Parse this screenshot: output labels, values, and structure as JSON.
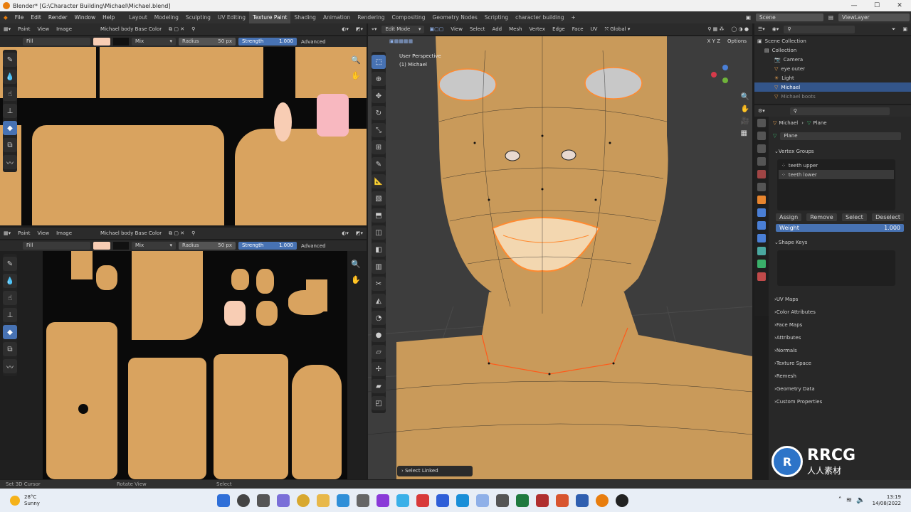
{
  "titlebar": {
    "title": "Blender* [G:\\Character Building\\Michael\\Michael.blend]",
    "min": "—",
    "max": "☐",
    "close": "✕"
  },
  "menu": [
    "File",
    "Edit",
    "Render",
    "Window",
    "Help"
  ],
  "workspaces": [
    "Layout",
    "Modeling",
    "Sculpting",
    "UV Editing",
    "Texture Paint",
    "Shading",
    "Animation",
    "Rendering",
    "Compositing",
    "Geometry Nodes",
    "Scripting",
    "character building",
    "+"
  ],
  "active_workspace": "Texture Paint",
  "scene": {
    "label": "Scene",
    "viewlayer": "ViewLayer"
  },
  "image_editor_top": {
    "mode": "Paint",
    "view": "View",
    "image": "Image",
    "image_name": "Michael body Base Color",
    "fill": "Fill",
    "blend": "Mix",
    "radius_label": "Radius",
    "radius_value": "50 px",
    "strength_label": "Strength",
    "strength_value": "1.000",
    "advanced": "Advanced"
  },
  "image_editor_bottom": {
    "mode": "Paint",
    "view": "View",
    "image": "Image",
    "image_name": "Michael body Base Color",
    "fill": "Fill",
    "blend": "Mix",
    "radius_label": "Radius",
    "radius_value": "50 px",
    "strength_label": "Strength",
    "strength_value": "1.000",
    "advanced": "Advanced"
  },
  "viewport": {
    "mode": "Edit Mode",
    "menus": [
      "View",
      "Select",
      "Add",
      "Mesh",
      "Vertex",
      "Edge",
      "Face",
      "UV"
    ],
    "orientation": "Global",
    "options": "Options",
    "overlay_line1": "User Perspective",
    "overlay_line2": "(1) Michael",
    "axes": [
      "X",
      "Y",
      "Z"
    ],
    "last_op": "Select Linked"
  },
  "outliner": {
    "scene_collection": "Scene Collection",
    "items": [
      {
        "name": "Collection",
        "selected": false
      },
      {
        "name": "Camera",
        "selected": false
      },
      {
        "name": "eye outer",
        "selected": false
      },
      {
        "name": "Light",
        "selected": false
      },
      {
        "name": "Michael",
        "selected": true
      },
      {
        "name": "Michael boots",
        "selected": false
      }
    ]
  },
  "properties": {
    "breadcrumb_object": "Michael",
    "breadcrumb_mesh": "Plane",
    "mesh_name": "Plane",
    "vertex_groups_title": "Vertex Groups",
    "vertex_groups": [
      "teeth upper",
      "teeth lower"
    ],
    "assign": "Assign",
    "remove": "Remove",
    "select": "Select",
    "deselect": "Deselect",
    "weight_label": "Weight",
    "weight_value": "1.000",
    "shape_keys_title": "Shape Keys",
    "panels": [
      "UV Maps",
      "Color Attributes",
      "Face Maps",
      "Attributes",
      "Normals",
      "Texture Space",
      "Remesh",
      "Geometry Data",
      "Custom Properties"
    ]
  },
  "status": {
    "left": "Set 3D Cursor",
    "mid": "Rotate View",
    "right": "Select"
  },
  "taskbar": {
    "temp": "28°C",
    "weather": "Sunny",
    "time": "13:19",
    "date": "14/08/2022"
  },
  "watermark": {
    "big": "RRCG",
    "small": "人人素材"
  }
}
